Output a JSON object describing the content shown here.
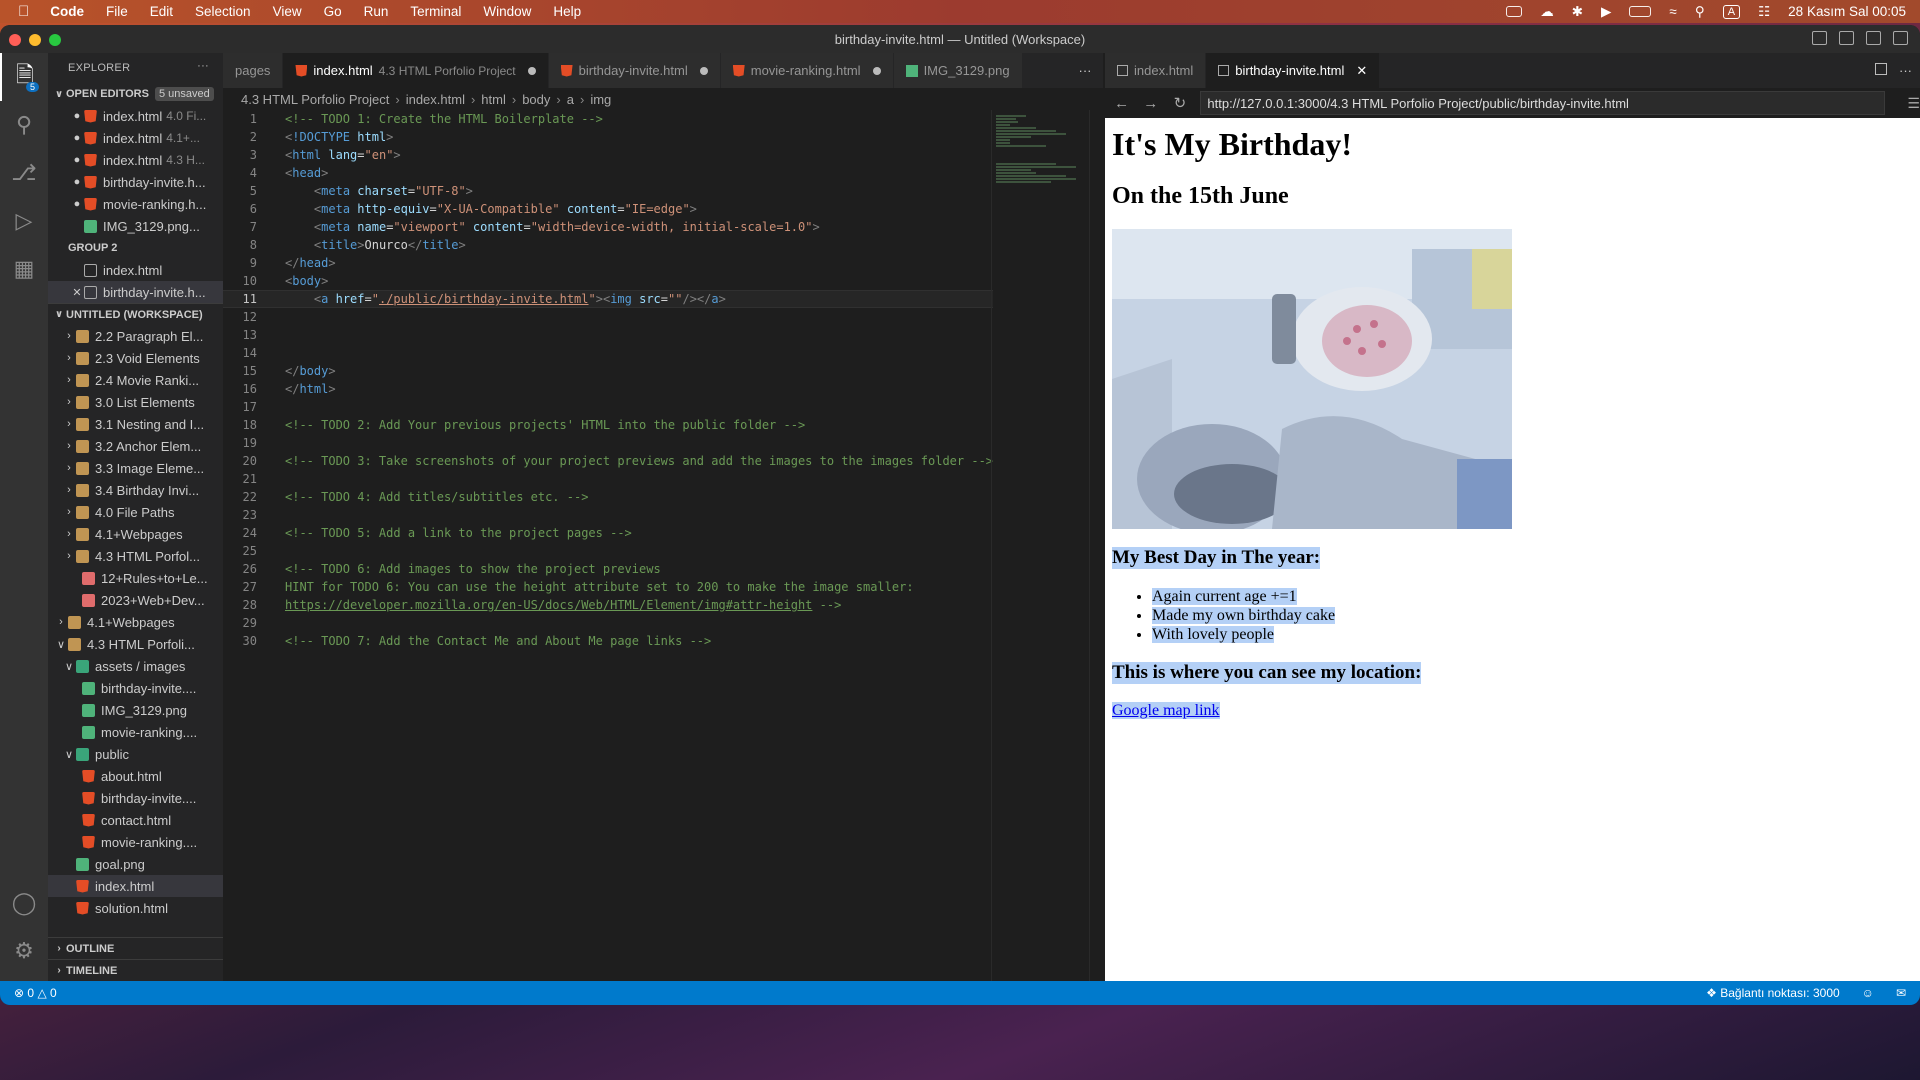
{
  "menubar": {
    "app": "Code",
    "items": [
      "File",
      "Edit",
      "Selection",
      "View",
      "Go",
      "Run",
      "Terminal",
      "Window",
      "Help"
    ],
    "clock": "28 Kasım Sal  00:05",
    "input_source": "A"
  },
  "window": {
    "title": "birthday-invite.html — Untitled (Workspace)"
  },
  "activity": {
    "explorer_badge": "5"
  },
  "explorer": {
    "title": "EXPLORER",
    "more": "···",
    "open_editors": {
      "label": "OPEN EDITORS",
      "unsaved": "5 unsaved",
      "items": [
        {
          "name": "index.html",
          "desc": "4.0 Fi...",
          "icon": "html-icon"
        },
        {
          "name": "index.html",
          "desc": "4.1+...",
          "icon": "html-icon"
        },
        {
          "name": "index.html",
          "desc": "4.3 H...",
          "icon": "html-icon"
        },
        {
          "name": "birthday-invite.h...",
          "desc": "",
          "icon": "html-icon"
        },
        {
          "name": "movie-ranking.h...",
          "desc": "",
          "icon": "html-icon"
        },
        {
          "name": "IMG_3129.png...",
          "desc": "",
          "icon": "image-icon"
        }
      ]
    },
    "group2": {
      "label": "GROUP 2",
      "items": [
        {
          "name": "index.html"
        },
        {
          "name": "birthday-invite.h..."
        }
      ]
    },
    "workspace": {
      "label": "UNTITLED (WORKSPACE)",
      "folders": [
        "2.2 Paragraph El...",
        "2.3 Void Elements",
        "2.4 Movie Ranki...",
        "3.0 List Elements",
        "3.1 Nesting and I...",
        "3.2 Anchor Elem...",
        "3.3 Image Eleme...",
        "3.4 Birthday Invi...",
        "4.0 File Paths",
        "4.1+Webpages",
        "4.3 HTML Porfol..."
      ],
      "files": [
        "12+Rules+to+Le...",
        "2023+Web+Dev..."
      ],
      "root_folders": [
        "4.1+Webpages",
        "4.3 HTML Porfoli..."
      ],
      "assets": "assets / images",
      "asset_files": [
        "birthday-invite....",
        "IMG_3129.png",
        "movie-ranking...."
      ],
      "public": "public",
      "public_files": [
        "about.html",
        "birthday-invite....",
        "contact.html",
        "movie-ranking...."
      ],
      "root_files": [
        "goal.png",
        "index.html",
        "solution.html"
      ]
    },
    "outline": "OUTLINE",
    "timeline": "TIMELINE"
  },
  "editor": {
    "tabs": [
      {
        "label": "pages",
        "desc": ""
      },
      {
        "label": "index.html",
        "desc": "4.3 HTML Porfolio Project"
      },
      {
        "label": "birthday-invite.html",
        "desc": ""
      },
      {
        "label": "movie-ranking.html",
        "desc": ""
      },
      {
        "label": "IMG_3129.png",
        "desc": ""
      }
    ],
    "more": "···",
    "breadcrumb": [
      "4.3 HTML Porfolio Project",
      "index.html",
      "html",
      "body",
      "a",
      "img"
    ],
    "current_line": 11
  },
  "browser": {
    "tabs": [
      {
        "label": "index.html"
      },
      {
        "label": "birthday-invite.html"
      }
    ],
    "url": "http://127.0.0.1:3000/4.3 HTML Porfolio Project/public/birthday-invite.html",
    "page": {
      "h1": "It's My Birthday!",
      "h2": "On the 15th June",
      "h3a": "My Best Day in The year:",
      "list": [
        "Again current age +=1",
        "Made my own birthday cake",
        "With lovely people"
      ],
      "h3b": "This is where you can see my location:",
      "link": "Google map link"
    }
  },
  "statusbar": {
    "errors": "0",
    "warnings": "0",
    "port": "Bağlantı noktası: 3000"
  },
  "colors": {
    "accent": "#007acc",
    "html_icon": "#e44d26",
    "selection": "#b4d0f6"
  }
}
